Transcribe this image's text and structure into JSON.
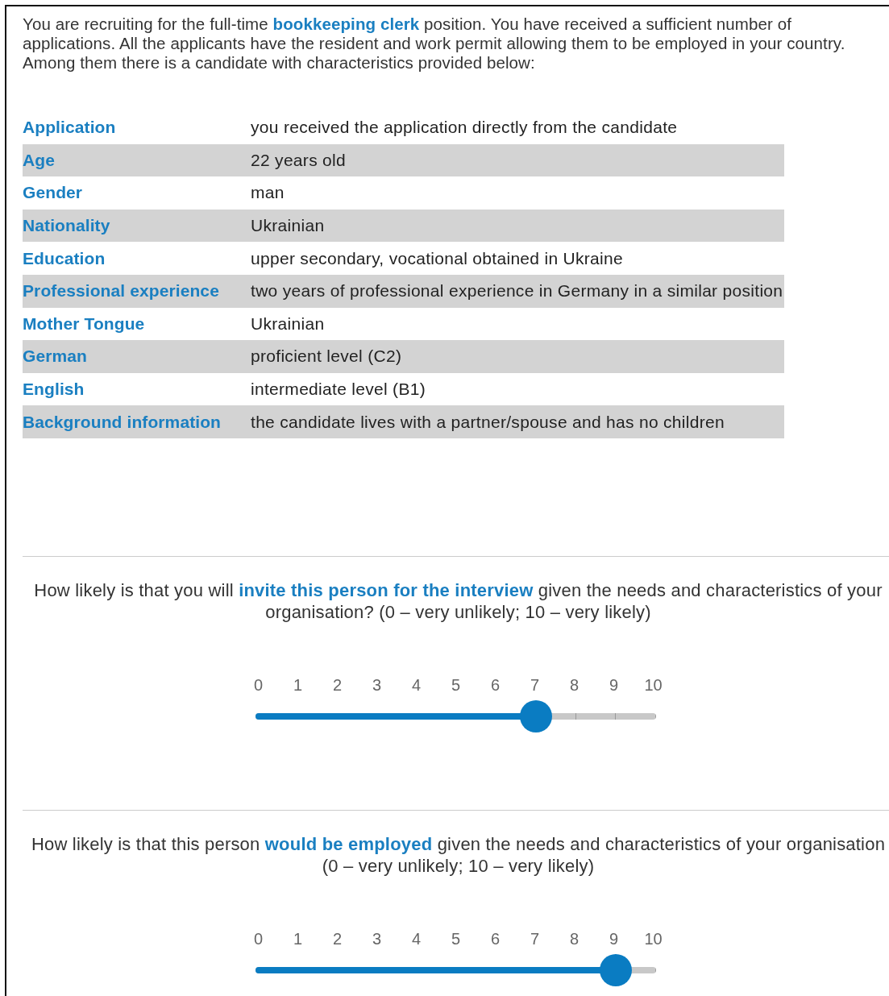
{
  "intro": "You are recruiting for the full-time **bookkeeping clerk** position. You have received a sufficient number of applications. All the applicants have the resident and work permit allowing them to be employed in your country. Among them there is a candidate with characteristics provided below:",
  "profile": [
    {
      "label": "Application",
      "value": "you received the application directly from the candidate"
    },
    {
      "label": "Age",
      "value": "22 years old"
    },
    {
      "label": "Gender",
      "value": "man"
    },
    {
      "label": "Nationality",
      "value": "Ukrainian"
    },
    {
      "label": "Education",
      "value": "upper secondary, vocational obtained in Ukraine"
    },
    {
      "label": "Professional experience",
      "value": "two years of professional experience in Germany in a similar position"
    },
    {
      "label": "Mother Tongue",
      "value": "Ukrainian"
    },
    {
      "label": "German",
      "value": "proficient level (C2)"
    },
    {
      "label": "English",
      "value": "intermediate level (B1)"
    },
    {
      "label": "Background information",
      "value": "the candidate lives with a partner/spouse and has no children"
    }
  ],
  "questions": [
    {
      "text": "How likely is that you will **invite this person for the interview** given the needs and characteristics of your organisation? (0 – very unlikely; 10 – very likely)",
      "ticks": [
        "0",
        "1",
        "2",
        "3",
        "4",
        "5",
        "6",
        "7",
        "8",
        "9",
        "10"
      ],
      "level": 0.7
    },
    {
      "text": "How likely is that this person **would be employed** given the needs and characteristics of your organisation (0 – very unlikely; 10 – very likely)",
      "ticks": [
        "0",
        "1",
        "2",
        "3",
        "4",
        "5",
        "6",
        "7",
        "8",
        "9",
        "10"
      ],
      "level": 0.9
    }
  ]
}
